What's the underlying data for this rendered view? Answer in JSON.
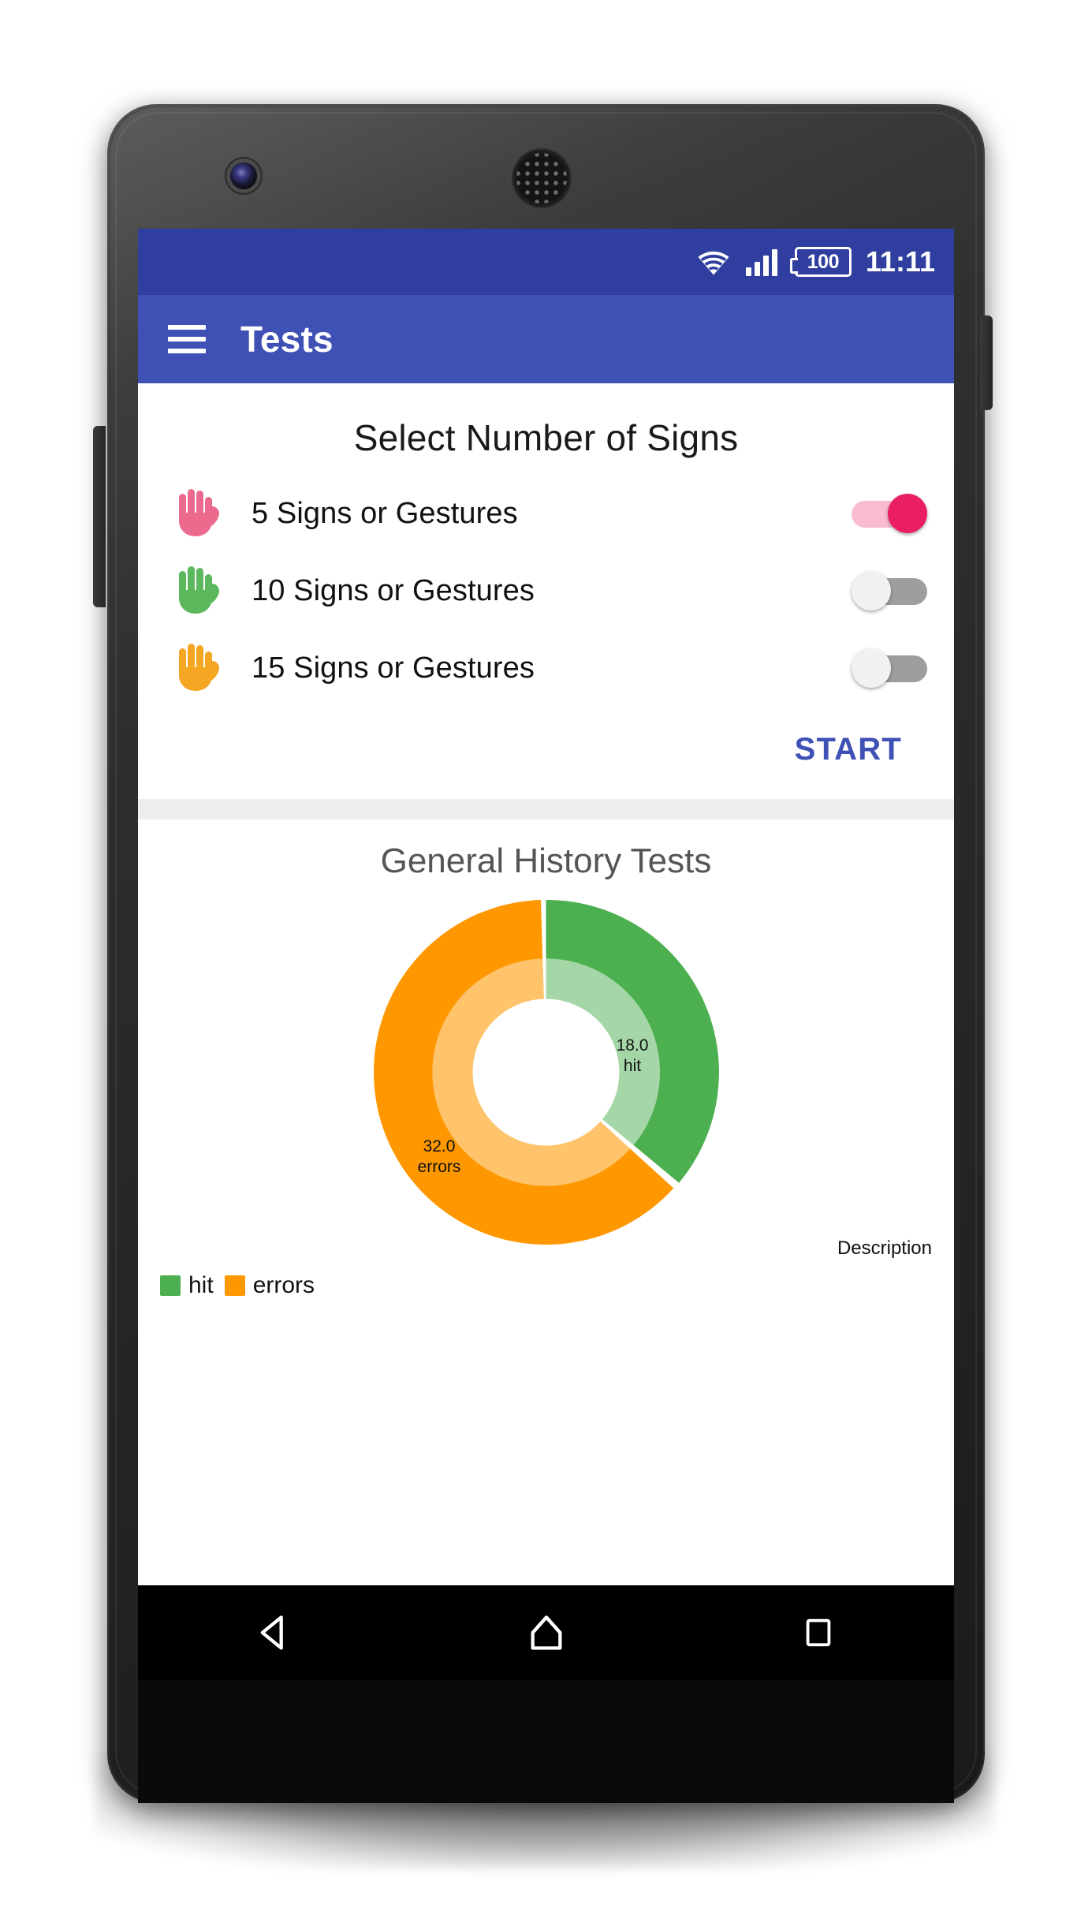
{
  "status_bar": {
    "wifi_icon": "wifi-icon",
    "signal_icon": "signal-bars-icon",
    "battery_icon": "battery-icon",
    "battery_level": "100",
    "time": "11:11",
    "background_color": "#303f9f"
  },
  "app_bar": {
    "menu_icon": "hamburger-menu-icon",
    "title": "Tests",
    "background_color": "#3f51b5"
  },
  "select_card": {
    "heading": "Select Number of Signs",
    "options": [
      {
        "icon": "hand-icon",
        "icon_color": "#ec6a8e",
        "label": "5 Signs or Gestures",
        "enabled": true,
        "state": "on",
        "track_color": "#f8bbd0",
        "thumb_color": "#e91e63"
      },
      {
        "icon": "hand-icon",
        "icon_color": "#5cb85c",
        "label": "10 Signs or Gestures",
        "enabled": false,
        "state": "off",
        "track_color": "#9e9e9e",
        "thumb_color": "#f1f1f1"
      },
      {
        "icon": "hand-icon",
        "icon_color": "#f5a623",
        "label": "15 Signs or Gestures",
        "enabled": false,
        "state": "off",
        "track_color": "#9e9e9e",
        "thumb_color": "#f1f1f1"
      }
    ],
    "start_label": "START",
    "start_color": "#3f51b5"
  },
  "chart_card": {
    "title": "General History Tests",
    "description_label": "Description"
  },
  "chart_data": {
    "type": "pie",
    "subtype": "donut-two-ring",
    "title": "General History Tests",
    "categories": [
      "hit",
      "errors"
    ],
    "values": [
      18.0,
      32.0
    ],
    "total": 50.0,
    "percentages": [
      36,
      64
    ],
    "labels": [
      {
        "value": "18.0",
        "name": "hit"
      },
      {
        "value": "32.0",
        "name": "errors"
      }
    ],
    "colors": [
      "#4caf50",
      "#ff9800"
    ],
    "inner_ring_colors": [
      "#a5d6a7",
      "#ffc46b"
    ],
    "start_angle_deg": 0,
    "direction": "clockwise",
    "legend": [
      {
        "label": "hit",
        "color": "#4caf50"
      },
      {
        "label": "errors",
        "color": "#ff9800"
      }
    ],
    "legend_position": "bottom-left",
    "grid": false,
    "annotations": [
      "Description"
    ]
  },
  "nav_bar": {
    "back_icon": "back-triangle-icon",
    "home_icon": "home-icon",
    "recents_icon": "recents-square-icon"
  },
  "device": {
    "front_camera_icon": "front-camera-icon",
    "earpiece_icon": "earpiece-speaker-icon"
  }
}
